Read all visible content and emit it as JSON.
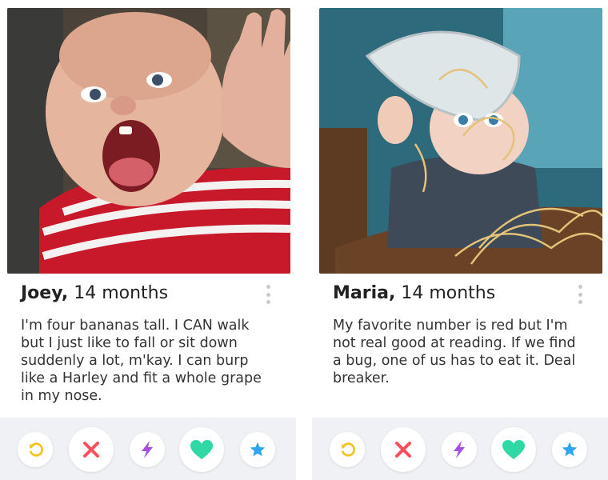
{
  "cards": [
    {
      "name": "Joey,",
      "age": "14 months",
      "bio": "I'm four bananas tall. I CAN walk but I just like to fall or sit down suddenly a lot, m'kay. I can burp like a Harley and fit a whole grape in my nose."
    },
    {
      "name": "Maria,",
      "age": "14 months",
      "bio": "My favorite number is red but I'm not real good at reading. If we find a bug, one of us has to eat it. Deal breaker."
    }
  ],
  "actions": [
    "rewind-icon",
    "nope-x-icon",
    "boost-bolt-icon",
    "like-heart-icon",
    "super-like-star-icon"
  ],
  "colors": {
    "rewind": "#f5c321",
    "nope": "#fd4e5d",
    "boost": "#a74ddf",
    "like": "#2fd8a5",
    "superlike": "#2ea6f2"
  }
}
